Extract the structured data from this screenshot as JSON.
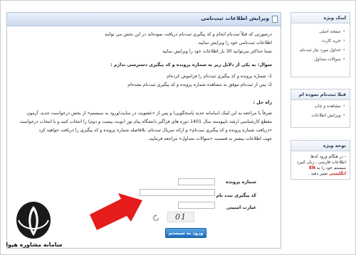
{
  "main": {
    "title": "ویرایش اطلاعات ثبت‌نامی",
    "intro": [
      "درصورتی که قبلاً ثبت‌نام انجام و کد پیگیری ثبت‌نام دریافت نموده‌اید در این بخش می توانید",
      "اطلاعات ثبت‌نامی خود را ویرایش نمایید.",
      "شما حداکثر می‌توانید 30 بار اطلاعات خود را ویرایش نمایید"
    ],
    "question": "سوال: به یکی از دلایل زیر به شماره پرونده و کد پیگیری دسترسی ندارم :",
    "reasons": [
      "1- شماره پرونده و کد پیگیری ثبت‌نام را فراموش کرده‌ام",
      "2- پس از ثبت‌نام موفق به مشاهده شماره پرونده و کد پیگیری ثبت‌نام نشده‌ام"
    ],
    "solution_heading": "راه حل :",
    "solution_lines": [
      "صرفاً با مراجعه به  این لینک (سامانه جدید پاسخگویی)  و پس از «عضویت در سایت/ورود به سیستم» از بخش درخواست جدید، آزمون",
      "مقطع کارشناسی ارشد ناپیوسته سال 1401 دوره های فراگیر دانشگاه پیام نور (نوبت بیست و دوم) را انتخاب کنید و با انتخاب درخواست",
      "«دریافت شماره پرونده و کد پیگیری ثبت‌نام» و ارائه سریال ثبت‌نام، بلافاصله شماره پرونده و کد پیگیری را دریافت خواهید کرد",
      "جهت اطلاعات بیشتر به قسمت «سوالات متداول» مراجعه فرمایید."
    ],
    "form": {
      "file_number_label": "شماره پرونده",
      "tracking_code_label": "کد پیگیری ثبت نام",
      "security_label": "عبارت امنیتی",
      "captcha_text": "01",
      "submit_label": "ورود به سیستم"
    }
  },
  "sidebar": {
    "links_box": {
      "title": "لینک ویژه",
      "items": [
        "صفحه اصلی",
        "خرید کارت",
        "جداول مورد نیاز ثبت‌نام",
        "سوالات متداول"
      ]
    },
    "applicant_box": {
      "title": "قبلا ثبت‌نام نموده ام",
      "items": [
        "مشاهده و چاپ",
        "ویرایش اطلاعات"
      ]
    },
    "notice_box": {
      "title": "توجه ویژه",
      "note_start": "- در هنگام ورود کدها اطلاعات فارسی ، زبان کیبرد سیستم خود را به ",
      "note_highlight": "EN انگلیسی",
      "note_end": " تغییر دهید ."
    }
  },
  "watermark": {
    "caption": "سامانه مشاوره هپوا"
  },
  "colors": {
    "accent": "#1e6fbe",
    "arrow": "#e51c1c",
    "header": "#cddbee"
  }
}
